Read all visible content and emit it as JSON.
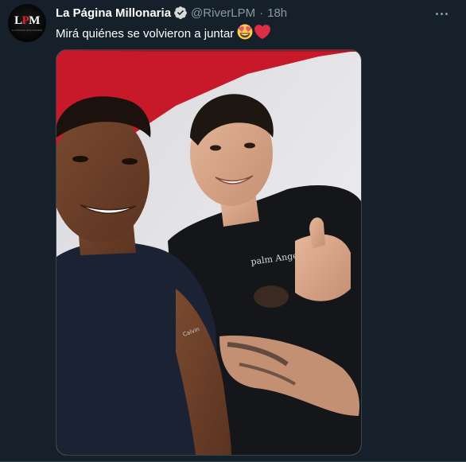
{
  "tweet": {
    "author": {
      "display_name": "La Página Millonaria",
      "handle": "@RiverLPM",
      "avatar_text": [
        "L",
        "P",
        "M"
      ],
      "avatar_subtext": "LA PÁGINA MILLONARIA",
      "verified": true
    },
    "separator": "·",
    "time": "18h",
    "text": "Mirá quiénes se volvieron a juntar",
    "emojis": [
      "heart-eyes-emoji",
      "red-heart-emoji"
    ],
    "media": {
      "type": "photo",
      "description_icon": "photo"
    }
  },
  "colors": {
    "background": "#15202b",
    "text_primary": "#ffffff",
    "text_secondary": "#8b98a5",
    "verified": "#d9d9d9",
    "border": "#38444d",
    "brand_red": "#e2242f"
  }
}
